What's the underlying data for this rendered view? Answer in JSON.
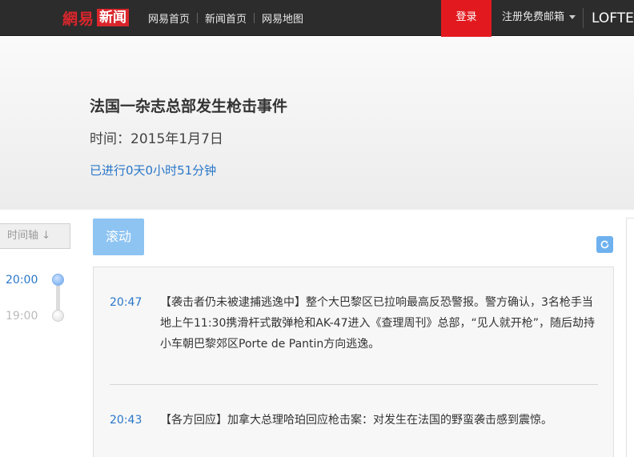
{
  "topbar": {
    "logo_part1": "網易",
    "logo_part2": "新闻",
    "nav": [
      "网易首页",
      "新闻首页",
      "网易地图"
    ],
    "login": "登录",
    "register": "注册免费邮箱",
    "lofter": "LOFTER"
  },
  "event": {
    "title": "法国一杂志总部发生枪击事件",
    "time": "时间：2015年1月7日",
    "elapsed": "已进行0天0小时51分钟"
  },
  "timeline": {
    "button": "时间轴 ↓",
    "hours": [
      {
        "label": "20:00",
        "active": true
      },
      {
        "label": "19:00",
        "active": false
      }
    ]
  },
  "controls": {
    "scroll": "滚动",
    "refresh_icon": "refresh-icon"
  },
  "feed": [
    {
      "time": "20:47",
      "text": "【袭击者仍未被逮捕逃逸中】整个大巴黎区已拉响最高反恐警报。警方确认，3名枪手当地上午11:30携滑杆式散弹枪和AK-47进入《查理周刊》总部，“见人就开枪”，随后劫持小车朝巴黎郊区Porte de Pantin方向逃逸。"
    },
    {
      "time": "20:43",
      "text": "【各方回应】加拿大总理哈珀回应枪击案：对发生在法国的野蛮袭击感到震惊。"
    }
  ],
  "colors": {
    "accent": "#2a77c9",
    "login_red": "#e21a1f",
    "scroll_btn": "#8ec4f2"
  }
}
